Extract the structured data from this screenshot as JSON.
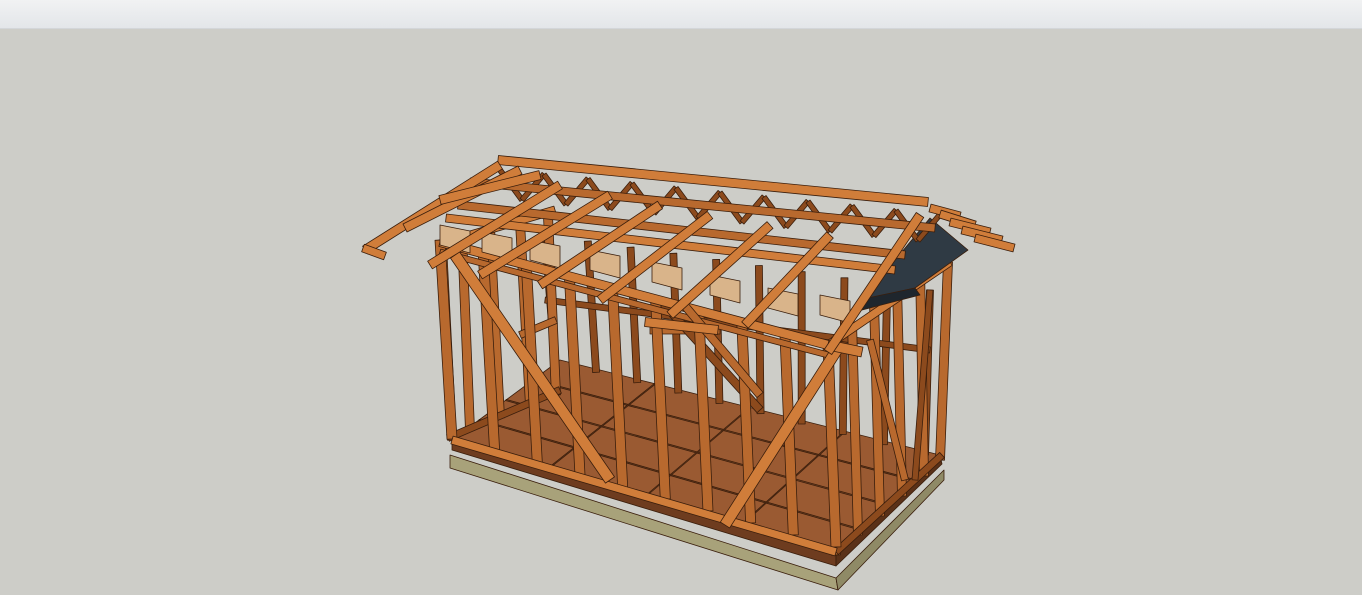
{
  "app": {
    "toolbar_label": "",
    "viewport_label": ""
  },
  "model": {
    "subject": "shed-frame-3d-model",
    "colors": {
      "background": "#cdcdc8",
      "wood": "#b8692e",
      "wood_dark": "#8c4a1d",
      "wood_light": "#d07d3a",
      "floor": "#9a5a32",
      "floor_dark": "#6e3c1f",
      "foundation": "#a8a27a",
      "gusset": "#d9b48a",
      "roof_panel": "#2f3a44",
      "edge": "#3a1e0c"
    }
  }
}
